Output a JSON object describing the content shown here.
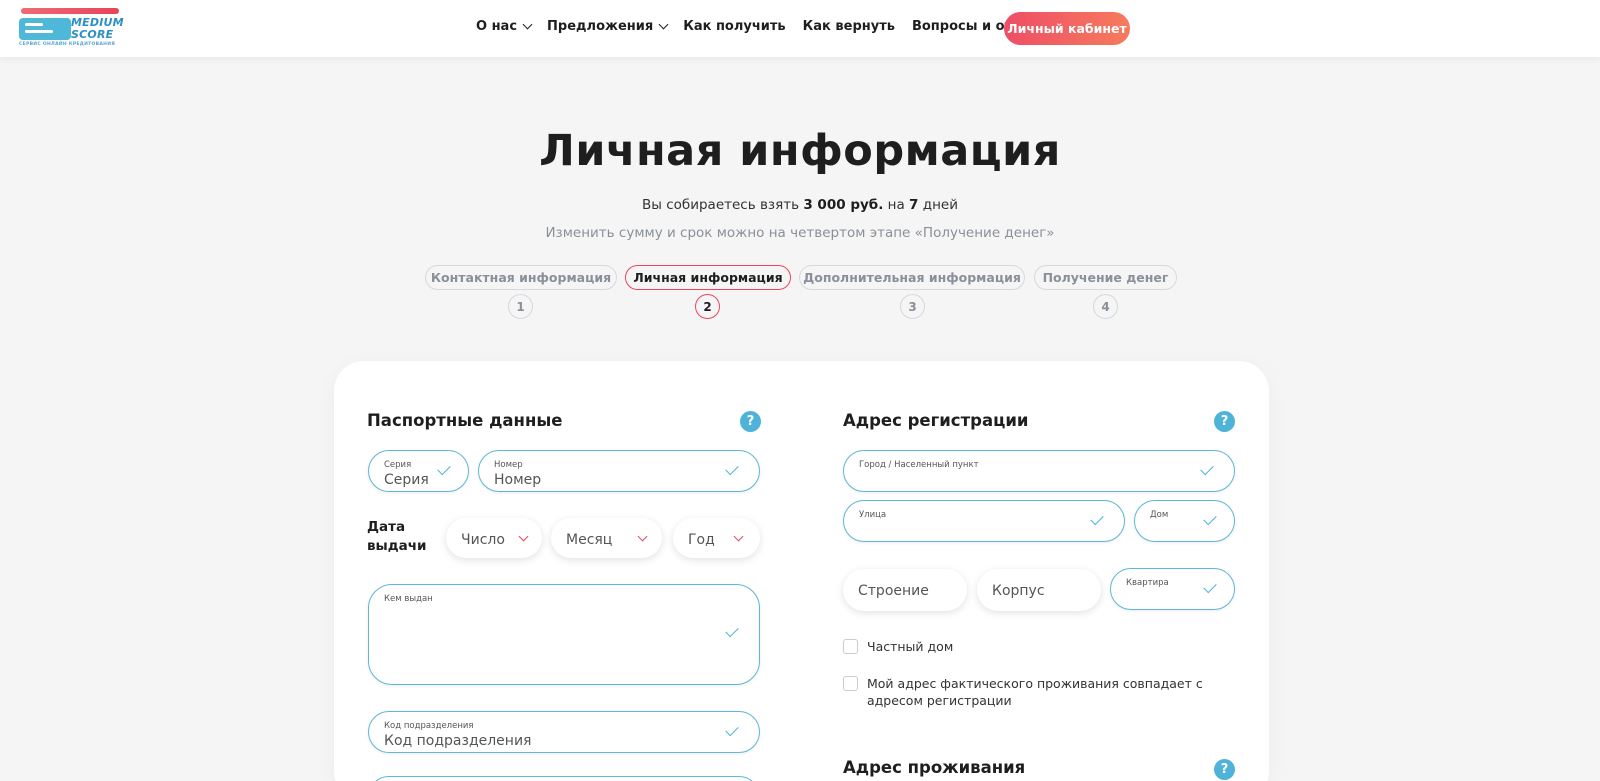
{
  "header": {
    "logo": {
      "line1": "MEDIUM",
      "line2": "SCORE",
      "tagline": "СЕРВИС ОНЛАЙН КРЕДИТОВАНИЯ"
    },
    "nav": [
      {
        "label": "О нас",
        "has_dropdown": true
      },
      {
        "label": "Предложения",
        "has_dropdown": true
      },
      {
        "label": "Как получить",
        "has_dropdown": false
      },
      {
        "label": "Как вернуть",
        "has_dropdown": false
      },
      {
        "label": "Вопросы и ответы",
        "has_dropdown": false
      }
    ],
    "cabinet_label": "Личный кабинет"
  },
  "page": {
    "title": "Личная информация",
    "summary_prefix": "Вы собираетесь взять",
    "amount": "3 000 руб.",
    "summary_mid": "на",
    "days": "7",
    "summary_suffix": "дней",
    "hint": "Изменить сумму и срок можно на четвертом этапе «Получение денег»"
  },
  "steps": [
    {
      "label": "Контактная информация",
      "number": "1",
      "active": false
    },
    {
      "label": "Личная информация",
      "number": "2",
      "active": true
    },
    {
      "label": "Дополнительная информация",
      "number": "3",
      "active": false
    },
    {
      "label": "Получение денег",
      "number": "4",
      "active": false
    }
  ],
  "passport": {
    "title": "Паспортные данные",
    "help": "?",
    "series": {
      "label": "Серия",
      "value": "Серия"
    },
    "number": {
      "label": "Номер",
      "value": "Номер"
    },
    "issue_date_label": "Дата выдачи",
    "day": "Число",
    "month": "Месяц",
    "year": "Год",
    "issued_by": {
      "label": "Кем выдан",
      "value": ""
    },
    "division_code": {
      "label": "Код подразделения",
      "value": "Код подразделения"
    }
  },
  "registration": {
    "title": "Адрес регистрации",
    "help": "?",
    "city": {
      "label": "Город / Населенный пункт",
      "value": ""
    },
    "street": {
      "label": "Улица",
      "value": ""
    },
    "house": {
      "label": "Дом",
      "value": ""
    },
    "building": "Строение",
    "korpus": "Корпус",
    "apartment": {
      "label": "Квартира",
      "value": ""
    },
    "private_house": "Частный дом",
    "same_address": "Мой адрес фактического проживания совпадает с адресом регистрации"
  },
  "residence": {
    "title": "Адрес проживания",
    "help": "?"
  },
  "colors": {
    "accent": "#e8475f",
    "field_border": "#5cb8d6",
    "help_bg": "#4fb3d9"
  }
}
